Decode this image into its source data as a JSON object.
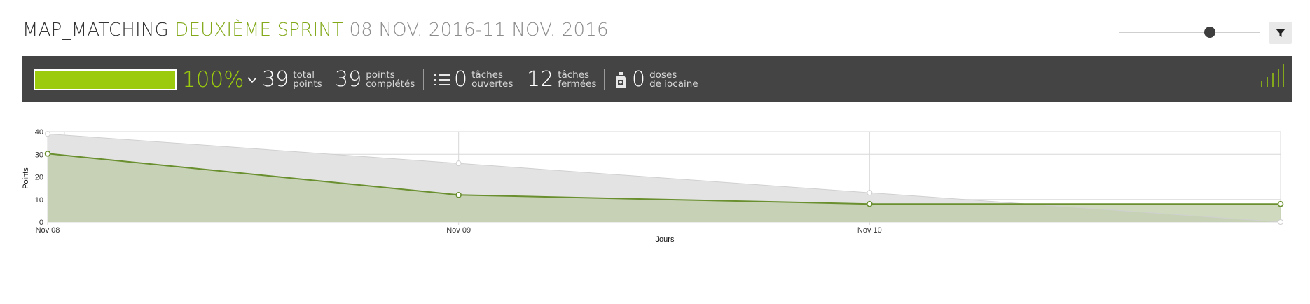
{
  "header": {
    "project": "MAP_MATCHING",
    "sprint": "DEUXIÈME SPRINT",
    "dates": "08 NOV. 2016-11 NOV. 2016"
  },
  "slider": {
    "value": 0.75
  },
  "summary": {
    "progress_fraction": 1.0,
    "percent": "100%",
    "total_points": "39",
    "total_label_1": "total",
    "total_label_2": "points",
    "completed_points": "39",
    "completed_label_1": "points",
    "completed_label_2": "complétés",
    "open_tasks": "0",
    "open_label_1": "tâches",
    "open_label_2": "ouvertes",
    "closed_tasks": "12",
    "closed_label_1": "tâches",
    "closed_label_2": "fermées",
    "iocaine": "0",
    "iocaine_label_1": "doses",
    "iocaine_label_2": "de iocaine"
  },
  "colors": {
    "accent": "#9bcb0c",
    "bar_bg": "#444444",
    "ideal_fill": "#e3e3e3",
    "real_line": "#6a8f2e",
    "real_fill": "#b9c9a2"
  },
  "chart_data": {
    "type": "area",
    "xlabel": "Jours",
    "ylabel": "Points",
    "ylim": [
      0,
      40
    ],
    "yticks": [
      0,
      10,
      20,
      30,
      40
    ],
    "x": [
      0,
      1,
      2,
      3
    ],
    "xticks": [
      {
        "x": 0,
        "label": "Nov 08"
      },
      {
        "x": 1,
        "label": "Nov 09"
      },
      {
        "x": 2,
        "label": "Nov 10"
      }
    ],
    "xlim": [
      0,
      3
    ],
    "grid": true,
    "series": [
      {
        "values": [
          39,
          26,
          13,
          0
        ]
      },
      {
        "values": [
          30.3,
          12,
          8,
          8
        ]
      }
    ]
  }
}
